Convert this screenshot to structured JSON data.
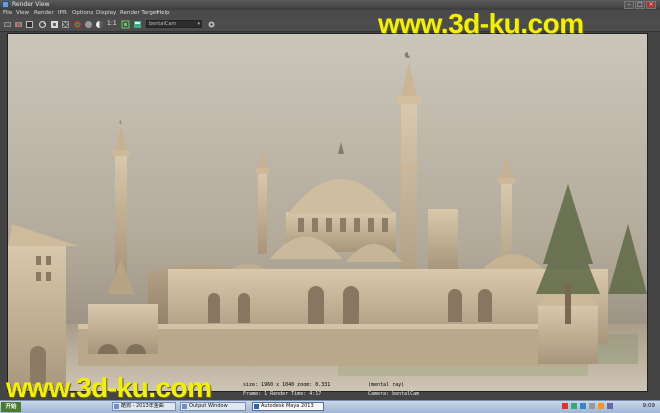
{
  "window": {
    "title": "Render View",
    "controls": [
      "–",
      "□",
      "×"
    ]
  },
  "menu": [
    "File",
    "View",
    "Render",
    "IPR",
    "Options",
    "Display",
    "Render Target",
    "Help"
  ],
  "toolbar": {
    "ratio_label": "1:1",
    "camera_select": "bentalCam"
  },
  "render_info": {
    "line1": "size: 1960 x 1040  zoom: 0.331",
    "line1_right": "(mental ray)",
    "line2": "Frame: 1   Render Time: 4:17",
    "line2_right": "Camera: bentalCam"
  },
  "watermark": {
    "top": "www.3d-ku.com",
    "bottom": "www.3d-ku.com",
    "color": "#f3ee12"
  },
  "taskbar": {
    "start_label": "开始",
    "tasks": [
      {
        "label": "酷狗 - 2013年金曲"
      },
      {
        "label": "Output Window"
      },
      {
        "label": "Autodesk Maya 2013"
      }
    ],
    "clock": "9:09"
  },
  "colors": {
    "sky_top": "#c9c3b7",
    "sky_bottom": "#8f877d",
    "building": "#c9b79c",
    "taskbar": "#b3c4dd"
  }
}
